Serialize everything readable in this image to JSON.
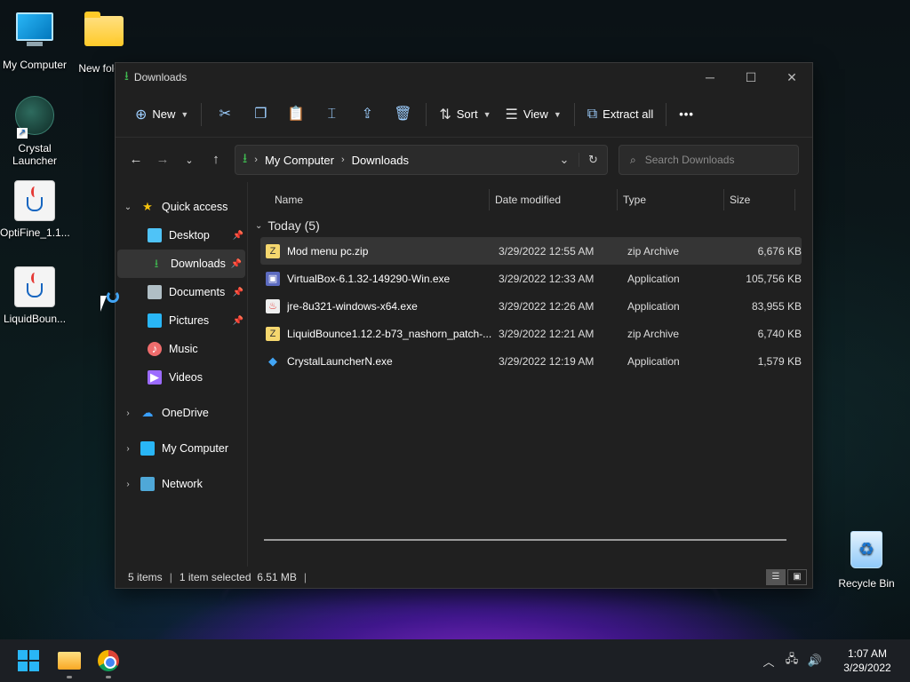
{
  "desktop": {
    "icons": [
      {
        "label": "My Computer"
      },
      {
        "label": "New folder"
      },
      {
        "label": "Crystal\nLauncher"
      },
      {
        "label": "OptiFine_1.1..."
      },
      {
        "label": "LiquidBoun..."
      },
      {
        "label": "Recycle Bin"
      }
    ]
  },
  "window": {
    "title": "Downloads",
    "controls": {
      "minimize": "─",
      "maximize": "☐",
      "close": "✕"
    }
  },
  "toolbar": {
    "new_label": "New",
    "sort_label": "Sort",
    "view_label": "View",
    "extract_label": "Extract all",
    "more_label": "•••"
  },
  "nav": {
    "breadcrumb": [
      "My Computer",
      "Downloads"
    ],
    "search_placeholder": "Search Downloads"
  },
  "sidebar": {
    "quick_access": "Quick access",
    "items": [
      {
        "label": "Desktop",
        "icon": "desktop-icon",
        "color": "#4fc3f7",
        "pinned": true
      },
      {
        "label": "Downloads",
        "icon": "downloads-icon",
        "color": "#3fb950",
        "pinned": true,
        "selected": true
      },
      {
        "label": "Documents",
        "icon": "documents-icon",
        "color": "#b0bec5",
        "pinned": true
      },
      {
        "label": "Pictures",
        "icon": "pictures-icon",
        "color": "#29b6f6",
        "pinned": true
      },
      {
        "label": "Music",
        "icon": "music-icon",
        "color": "#ef6c6c",
        "pinned": false
      },
      {
        "label": "Videos",
        "icon": "videos-icon",
        "color": "#9c6bff",
        "pinned": false
      }
    ],
    "onedrive": "OneDrive",
    "my_computer": "My Computer",
    "network": "Network"
  },
  "columns": [
    "Name",
    "Date modified",
    "Type",
    "Size"
  ],
  "group": {
    "label": "Today (5)"
  },
  "files": [
    {
      "name": "Mod menu pc.zip",
      "date": "3/29/2022 12:55 AM",
      "type": "zip Archive",
      "size": "6,676 KB",
      "icon": "zip-icon",
      "selected": true
    },
    {
      "name": "VirtualBox-6.1.32-149290-Win.exe",
      "date": "3/29/2022 12:33 AM",
      "type": "Application",
      "size": "105,756 KB",
      "icon": "virtualbox-icon",
      "selected": false
    },
    {
      "name": "jre-8u321-windows-x64.exe",
      "date": "3/29/2022 12:26 AM",
      "type": "Application",
      "size": "83,955 KB",
      "icon": "java-icon",
      "selected": false
    },
    {
      "name": "LiquidBounce1.12.2-b73_nashorn_patch-...",
      "date": "3/29/2022 12:21 AM",
      "type": "zip Archive",
      "size": "6,740 KB",
      "icon": "zip-icon",
      "selected": false
    },
    {
      "name": "CrystalLauncherN.exe",
      "date": "3/29/2022 12:19 AM",
      "type": "Application",
      "size": "1,579 KB",
      "icon": "crystal-icon",
      "selected": false
    }
  ],
  "status": {
    "items": "5 items",
    "selection": "1 item selected  6.51 MB"
  },
  "taskbar": {
    "time": "1:07 AM",
    "date": "3/29/2022"
  }
}
